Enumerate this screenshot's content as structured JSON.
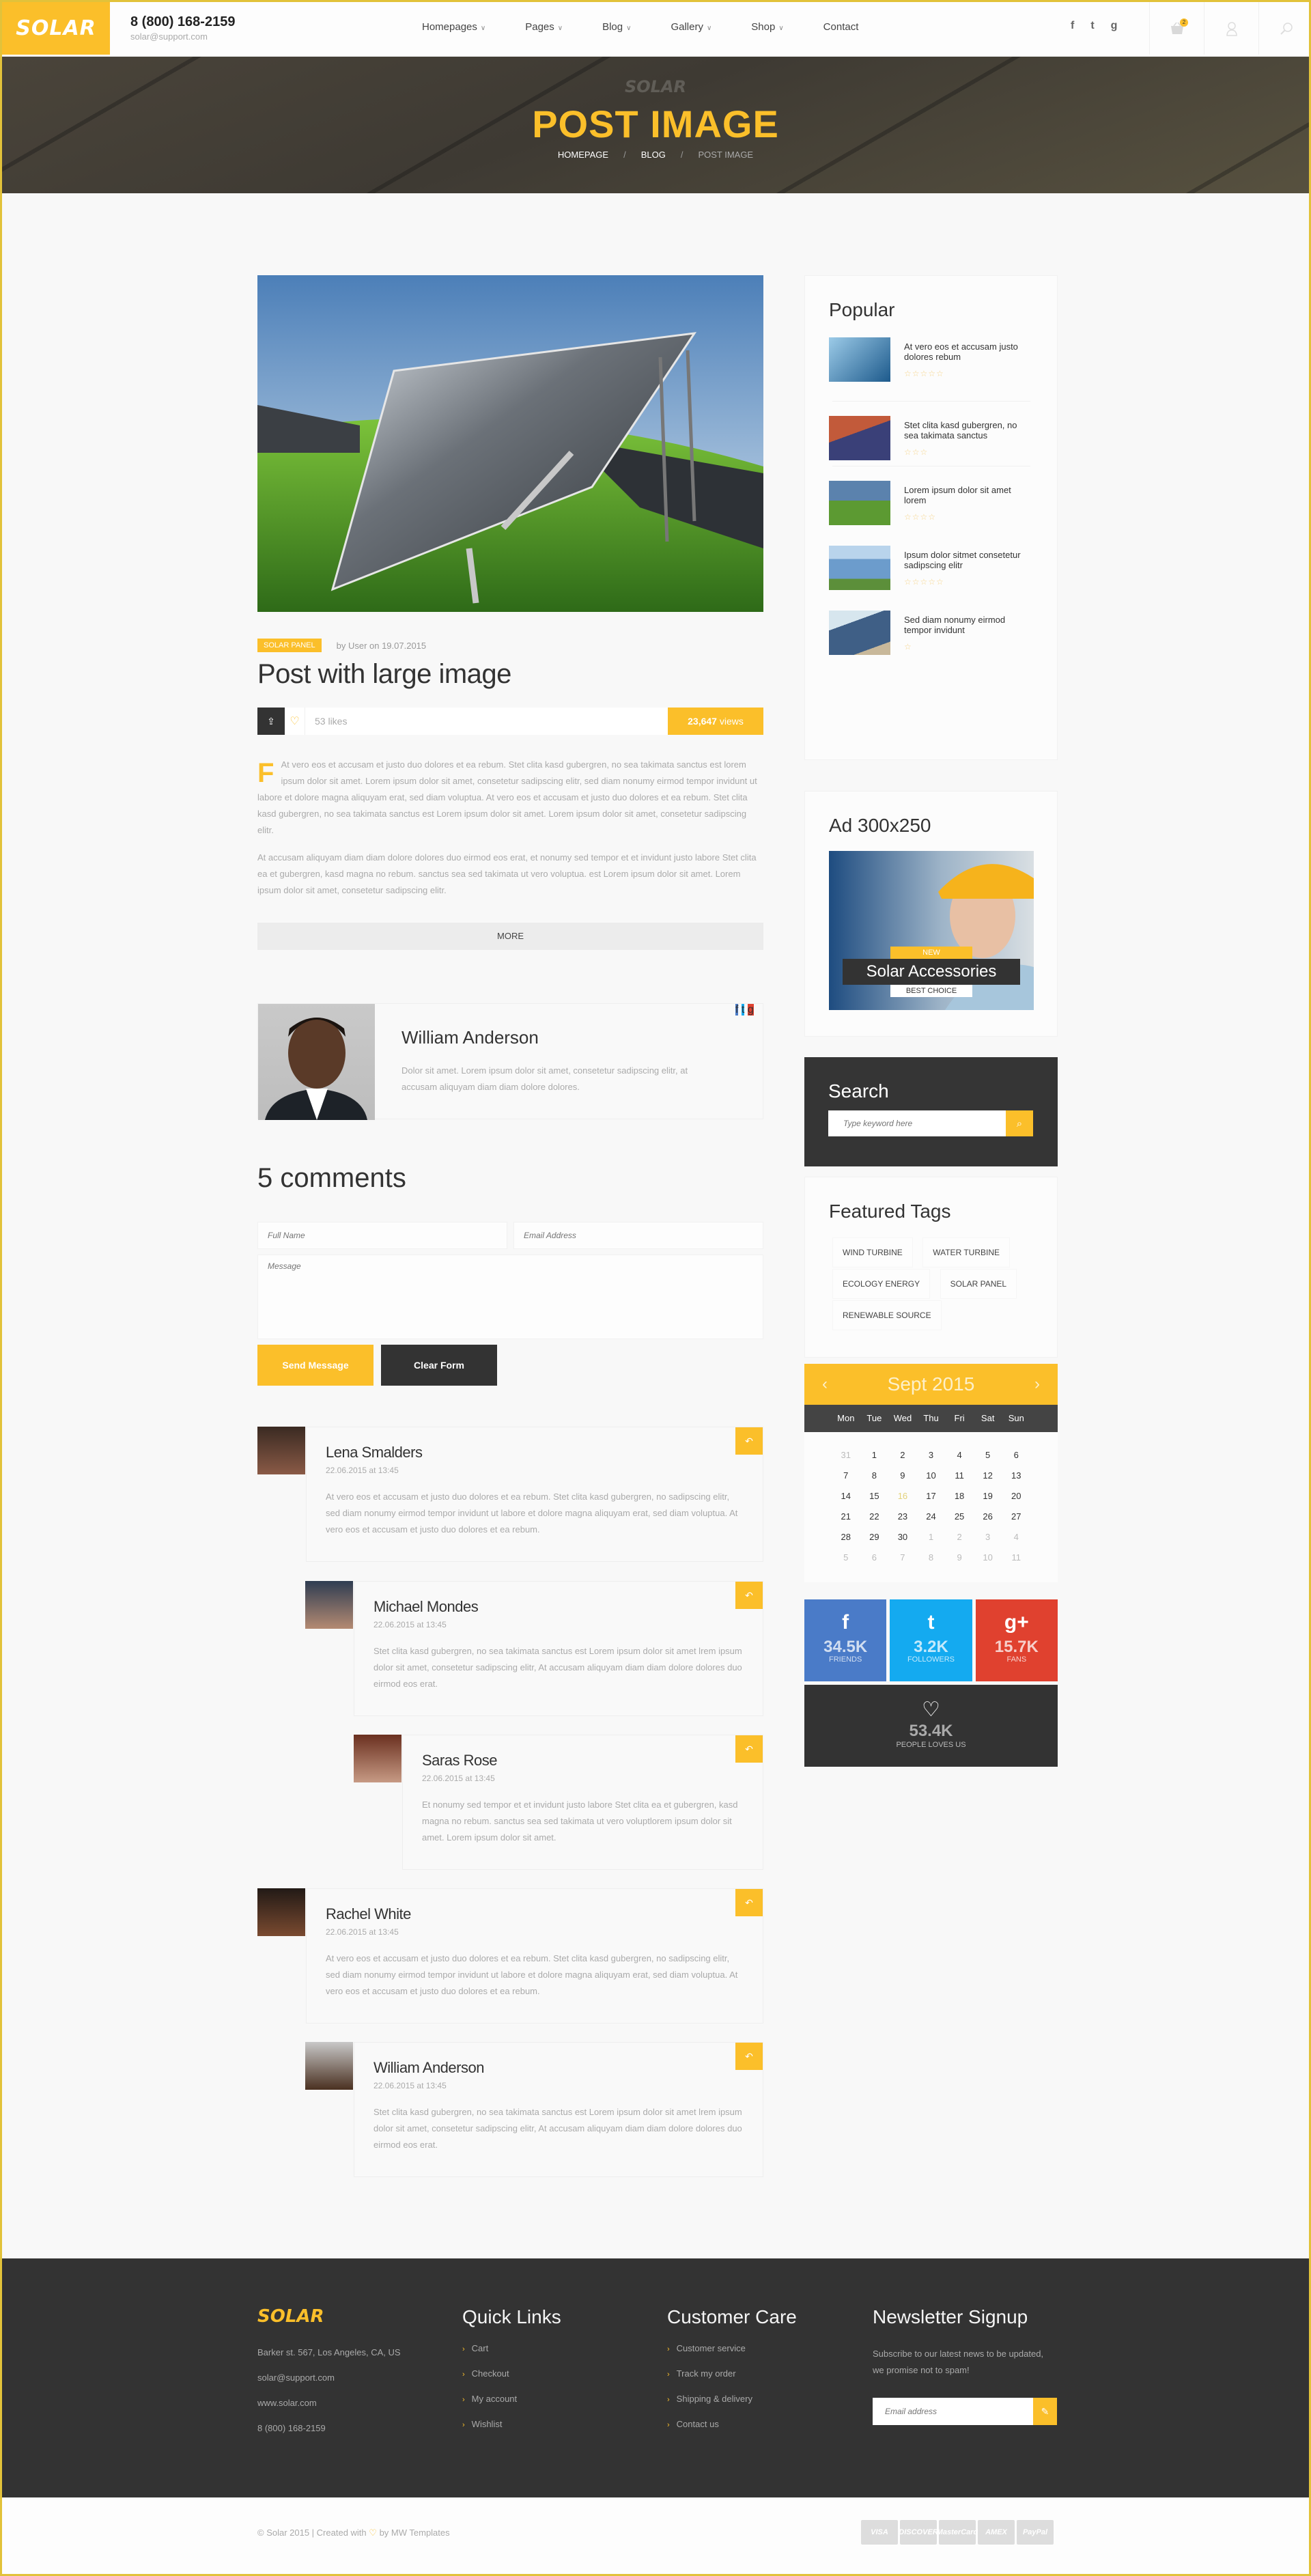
{
  "header": {
    "logo": "SOLAR",
    "phone": "8 (800) 168-2159",
    "email": "solar@support.com",
    "nav": [
      {
        "label": "Homepages",
        "has_dropdown": true
      },
      {
        "label": "Pages",
        "has_dropdown": true
      },
      {
        "label": "Blog",
        "has_dropdown": true
      },
      {
        "label": "Gallery",
        "has_dropdown": true
      },
      {
        "label": "Shop",
        "has_dropdown": true
      },
      {
        "label": "Contact",
        "has_dropdown": false
      }
    ],
    "social": [
      "f",
      "t",
      "g"
    ],
    "cart_count": "2"
  },
  "hero": {
    "watermark": "SOLAR",
    "title": "POST IMAGE",
    "breadcrumb": [
      "HOMEPAGE",
      "BLOG",
      "POST IMAGE"
    ],
    "separator": "/"
  },
  "post": {
    "category": "SOLAR PANEL",
    "byline": "by User on 19.07.2015",
    "title": "Post with large image",
    "likes": "53 likes",
    "views_count": "23,647",
    "views_label": "views",
    "dropcap": "F",
    "paragraph1": "At vero eos et accusam et justo duo dolores et ea rebum. Stet clita kasd gubergren, no sea takimata sanctus est lorem ipsum dolor sit amet. Lorem ipsum dolor sit amet, consetetur sadipscing elitr, sed diam nonumy eirmod tempor invidunt ut labore et dolore magna aliquyam erat, sed diam voluptua. At vero eos et accusam et justo duo dolores et ea rebum. Stet clita kasd gubergren, no sea takimata sanctus est Lorem ipsum dolor sit amet. Lorem ipsum dolor sit amet, consetetur sadipscing elitr.",
    "paragraph2": "At accusam aliquyam diam diam dolore dolores duo eirmod eos erat, et nonumy sed tempor et et invidunt justo labore Stet clita ea et gubergren, kasd magna no rebum. sanctus sea sed takimata ut vero voluptua. est Lorem ipsum dolor sit amet. Lorem ipsum dolor sit amet, consetetur sadipscing elitr.",
    "more_label": "MORE"
  },
  "author": {
    "name": "William Anderson",
    "bio": "Dolor sit amet. Lorem ipsum dolor sit amet, consetetur sadipscing elitr, at accusam aliquyam diam diam dolore dolores.",
    "social": [
      "f",
      "t",
      "g"
    ]
  },
  "comments": {
    "title": "5 comments",
    "form": {
      "name_placeholder": "Full Name",
      "email_placeholder": "Email Address",
      "message_placeholder": "Message",
      "send_label": "Send Message",
      "clear_label": "Clear Form"
    },
    "items": [
      {
        "name": "Lena Smalders",
        "date": "22.06.2015 at 13:45",
        "text": "At vero eos et accusam et justo duo dolores et ea rebum. Stet clita kasd gubergren, no sadipscing elitr, sed diam nonumy eirmod tempor invidunt ut labore et dolore magna aliquyam erat, sed diam voluptua. At vero eos et accusam et justo duo dolores et ea rebum."
      },
      {
        "name": "Michael Mondes",
        "date": "22.06.2015 at 13:45",
        "text": "Stet clita kasd gubergren, no sea takimata sanctus est Lorem ipsum dolor sit amet lrem ipsum dolor sit amet, consetetur sadipscing elitr, At accusam aliquyam diam diam dolore dolores duo eirmod eos erat."
      },
      {
        "name": "Saras Rose",
        "date": "22.06.2015 at 13:45",
        "text": "Et nonumy sed tempor et et invidunt justo labore Stet clita ea et gubergren, kasd magna no rebum. sanctus sea sed takimata ut vero voluptlorem ipsum dolor sit amet. Lorem ipsum dolor sit amet."
      },
      {
        "name": "Rachel White",
        "date": "22.06.2015 at 13:45",
        "text": "At vero eos et accusam et justo duo dolores et ea rebum. Stet clita kasd gubergren, no sadipscing elitr, sed diam nonumy eirmod tempor invidunt ut labore et dolore magna aliquyam erat, sed diam voluptua. At vero eos et accusam et justo duo dolores et ea rebum."
      },
      {
        "name": "William Anderson",
        "date": "22.06.2015 at 13:45",
        "text": "Stet clita kasd gubergren, no sea takimata sanctus est Lorem ipsum dolor sit amet lrem ipsum dolor sit amet, consetetur sadipscing elitr, At accusam aliquyam diam diam dolore dolores duo eirmod eos erat."
      }
    ]
  },
  "sidebar": {
    "popular": {
      "title": "Popular",
      "items": [
        {
          "text": "At vero eos et accusam justo dolores rebum",
          "stars": "☆☆☆☆☆"
        },
        {
          "text": "Stet clita kasd gubergren, no sea takimata sanctus",
          "stars": "☆☆☆"
        },
        {
          "text": "Lorem ipsum dolor sit amet lorem",
          "stars": "☆☆☆☆"
        },
        {
          "text": "Ipsum dolor sitmet consetetur sadipscing elitr",
          "stars": "☆☆☆☆☆"
        },
        {
          "text": "Sed diam nonumy eirmod tempor invidunt",
          "stars": "☆"
        }
      ]
    },
    "ad": {
      "title": "Ad 300x250",
      "badge": "NEW",
      "headline": "Solar Accessories",
      "sub": "BEST CHOICE"
    },
    "search": {
      "title": "Search",
      "placeholder": "Type keyword here"
    },
    "tags": {
      "title": "Featured Tags",
      "items": [
        "WIND TURBINE",
        "WATER TURBINE",
        "ECOLOGY ENERGY",
        "SOLAR PANEL",
        "RENEWABLE SOURCE"
      ]
    },
    "calendar": {
      "month": "Sept 2015",
      "prev": "‹",
      "next": "›",
      "weekdays": [
        "Mon",
        "Tue",
        "Wed",
        "Thu",
        "Fri",
        "Sat",
        "Sun"
      ],
      "days": [
        {
          "d": "31",
          "s": "muted"
        },
        {
          "d": "1"
        },
        {
          "d": "2"
        },
        {
          "d": "3"
        },
        {
          "d": "4"
        },
        {
          "d": "5"
        },
        {
          "d": "6"
        },
        {
          "d": "7"
        },
        {
          "d": "8"
        },
        {
          "d": "9"
        },
        {
          "d": "10"
        },
        {
          "d": "11"
        },
        {
          "d": "12"
        },
        {
          "d": "13"
        },
        {
          "d": "14"
        },
        {
          "d": "15"
        },
        {
          "d": "16",
          "s": "today"
        },
        {
          "d": "17"
        },
        {
          "d": "18"
        },
        {
          "d": "19"
        },
        {
          "d": "20"
        },
        {
          "d": "21"
        },
        {
          "d": "22"
        },
        {
          "d": "23"
        },
        {
          "d": "24"
        },
        {
          "d": "25"
        },
        {
          "d": "26"
        },
        {
          "d": "27"
        },
        {
          "d": "28"
        },
        {
          "d": "29"
        },
        {
          "d": "30"
        },
        {
          "d": "1",
          "s": "muted"
        },
        {
          "d": "2",
          "s": "muted"
        },
        {
          "d": "3",
          "s": "muted"
        },
        {
          "d": "4",
          "s": "muted"
        },
        {
          "d": "5",
          "s": "muted"
        },
        {
          "d": "6",
          "s": "muted"
        },
        {
          "d": "7",
          "s": "muted"
        },
        {
          "d": "8",
          "s": "muted"
        },
        {
          "d": "9",
          "s": "muted"
        },
        {
          "d": "10",
          "s": "muted"
        },
        {
          "d": "11",
          "s": "muted"
        }
      ]
    },
    "social_stats": [
      {
        "icon": "f",
        "count": "34.5K",
        "label": "FRIENDS",
        "color": "#4a7bc8"
      },
      {
        "icon": "t",
        "count": "3.2K",
        "label": "FOLLOWERS",
        "color": "#14aaf0"
      },
      {
        "icon": "g+",
        "count": "15.7K",
        "label": "FANS",
        "color": "#e0412f"
      }
    ],
    "loves": {
      "count": "53.4K",
      "label": "PEOPLE LOVES US"
    }
  },
  "footer": {
    "logo": "SOLAR",
    "address": "Barker st. 567, Los Angeles, CA, US",
    "email": "solar@support.com",
    "website": "www.solar.com",
    "phone": "8 (800) 168-2159",
    "quick_links": {
      "title": "Quick Links",
      "items": [
        "Cart",
        "Checkout",
        "My account",
        "Wishlist"
      ]
    },
    "customer_care": {
      "title": "Customer Care",
      "items": [
        "Customer service",
        "Track my order",
        "Shipping & delivery",
        "Contact us"
      ]
    },
    "newsletter": {
      "title": "Newsletter Signup",
      "text": "Subscribe to our latest news to be updated, we promise not to spam!",
      "placeholder": "Email address"
    },
    "copyright_pre": "© Solar 2015 | Created with",
    "copyright_post": "by MW Templates",
    "payments": [
      "VISA",
      "DISCOVER",
      "MasterCard",
      "AMEX",
      "PayPal"
    ]
  },
  "colors": {
    "accent": "#fbbf2a",
    "dark": "#333333",
    "facebook": "#4a7bc8",
    "twitter": "#14aaf0",
    "google": "#e0412f"
  }
}
